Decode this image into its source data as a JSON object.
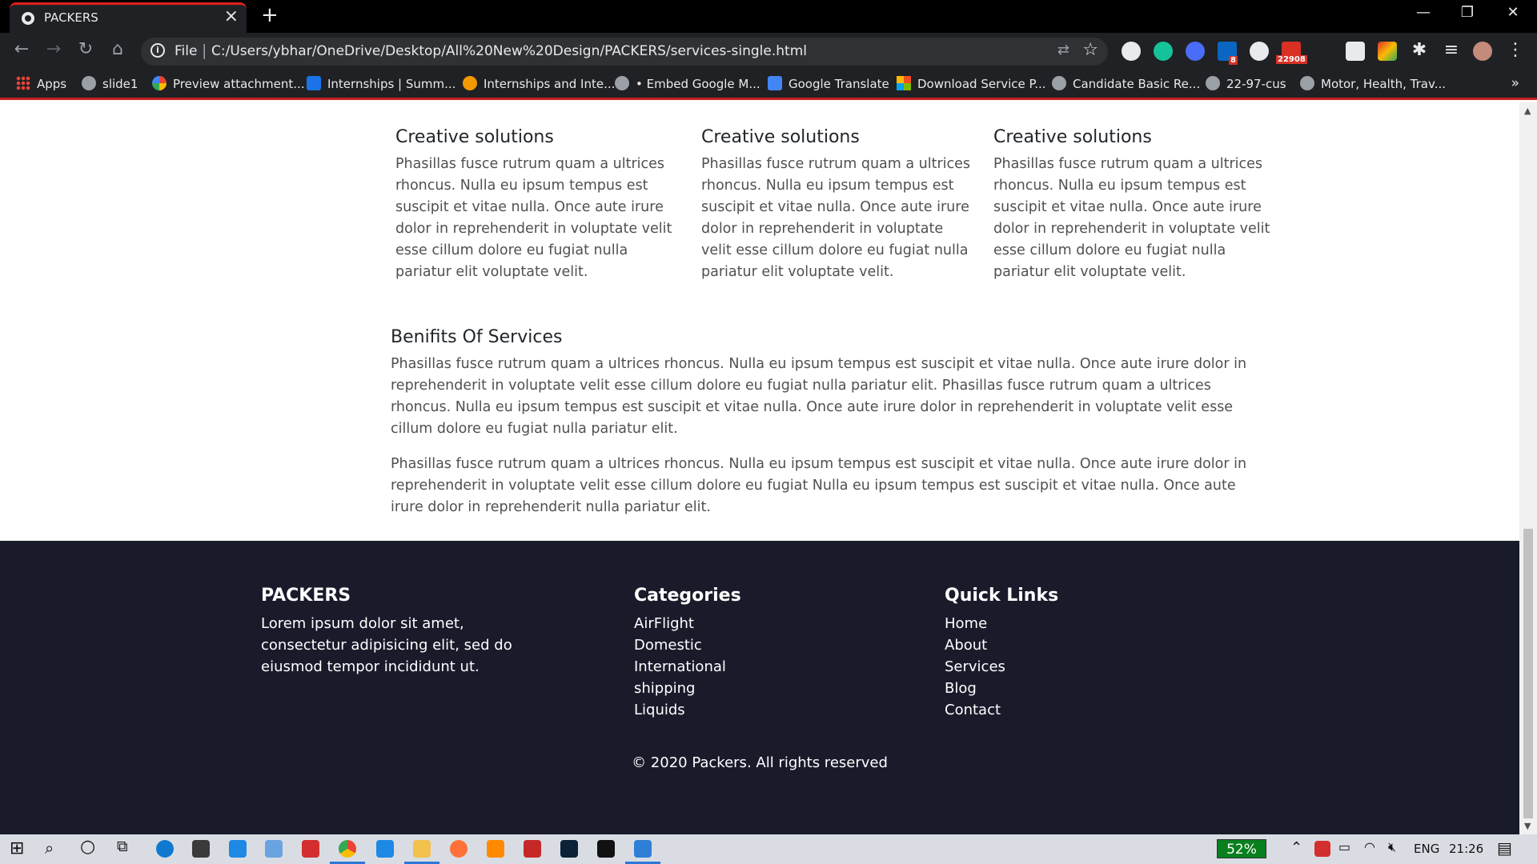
{
  "browser": {
    "tab_title": "PACKERS",
    "url_scheme": "File",
    "url": "C:/Users/ybhar/OneDrive/Desktop/All%20New%20Design/PACKERS/services-single.html",
    "extension_badges": {
      "linkedin": "8",
      "mail": "22908"
    }
  },
  "bookmarks": [
    {
      "label": "Apps",
      "icon": "apps-grid-icon"
    },
    {
      "label": "slide1",
      "icon": "globe-icon"
    },
    {
      "label": "Preview attachment...",
      "icon": "google-icon"
    },
    {
      "label": "Internships | Summ...",
      "icon": "is-icon"
    },
    {
      "label": "Internships and Inte...",
      "icon": "fire-icon"
    },
    {
      "label": "• Embed Google M...",
      "icon": "globe-icon"
    },
    {
      "label": "Google Translate",
      "icon": "translate-icon"
    },
    {
      "label": "Download Service P...",
      "icon": "microsoft-icon"
    },
    {
      "label": "Candidate Basic Re...",
      "icon": "globe-icon"
    },
    {
      "label": "22-97-cus",
      "icon": "globe-icon"
    },
    {
      "label": "Motor, Health, Trav...",
      "icon": "globe-icon"
    }
  ],
  "services": [
    {
      "title": "Creative solutions",
      "text": "Phasillas fusce rutrum quam a ultrices rhoncus. Nulla eu ipsum tempus est suscipit et vitae nulla. Once aute irure dolor in reprehenderit in voluptate velit esse cillum dolore eu fugiat nulla pariatur elit voluptate velit."
    },
    {
      "title": "Creative solutions",
      "text": "Phasillas fusce rutrum quam a ultrices rhoncus. Nulla eu ipsum tempus est suscipit et vitae nulla. Once aute irure dolor in reprehenderit in voluptate velit esse cillum dolore eu fugiat nulla pariatur elit voluptate velit."
    },
    {
      "title": "Creative solutions",
      "text": "Phasillas fusce rutrum quam a ultrices rhoncus. Nulla eu ipsum tempus est suscipit et vitae nulla. Once aute irure dolor in reprehenderit in voluptate velit esse cillum dolore eu fugiat nulla pariatur elit voluptate velit."
    }
  ],
  "benefits": {
    "title": "Benifits Of Services",
    "paragraphs": [
      "Phasillas fusce rutrum quam a ultrices rhoncus. Nulla eu ipsum tempus est suscipit et vitae nulla. Once aute irure dolor in reprehenderit in voluptate velit esse cillum dolore eu fugiat nulla pariatur elit. Phasillas fusce rutrum quam a ultrices rhoncus. Nulla eu ipsum tempus est suscipit et vitae nulla. Once aute irure dolor in reprehenderit in voluptate velit esse cillum dolore eu fugiat nulla pariatur elit.",
      "Phasillas fusce rutrum quam a ultrices rhoncus. Nulla eu ipsum tempus est suscipit et vitae nulla. Once aute irure dolor in reprehenderit in voluptate velit esse cillum dolore eu fugiat Nulla eu ipsum tempus est suscipit et vitae nulla. Once aute irure dolor in reprehenderit nulla pariatur elit."
    ]
  },
  "footer": {
    "brand": {
      "title": "PACKERS",
      "text": "Lorem ipsum dolor sit amet, consectetur adipisicing elit, sed do eiusmod tempor incididunt ut."
    },
    "categories": {
      "title": "Categories",
      "items": [
        "AirFlight",
        "Domestic",
        "International",
        "shipping",
        "Liquids"
      ]
    },
    "quick_links": {
      "title": "Quick Links",
      "items": [
        "Home",
        "About",
        "Services",
        "Blog",
        "Contact"
      ]
    },
    "copyright": "© 2020 Packers. All rights reserved"
  },
  "taskbar": {
    "battery_percent": "52%",
    "language": "ENG",
    "time": "21:26"
  },
  "colors": {
    "footer_bg": "#191b2b",
    "bookmark_bar_border": "#c5221f",
    "tab_accent": "#e02020",
    "battery_bg": "#0a7f1f"
  }
}
